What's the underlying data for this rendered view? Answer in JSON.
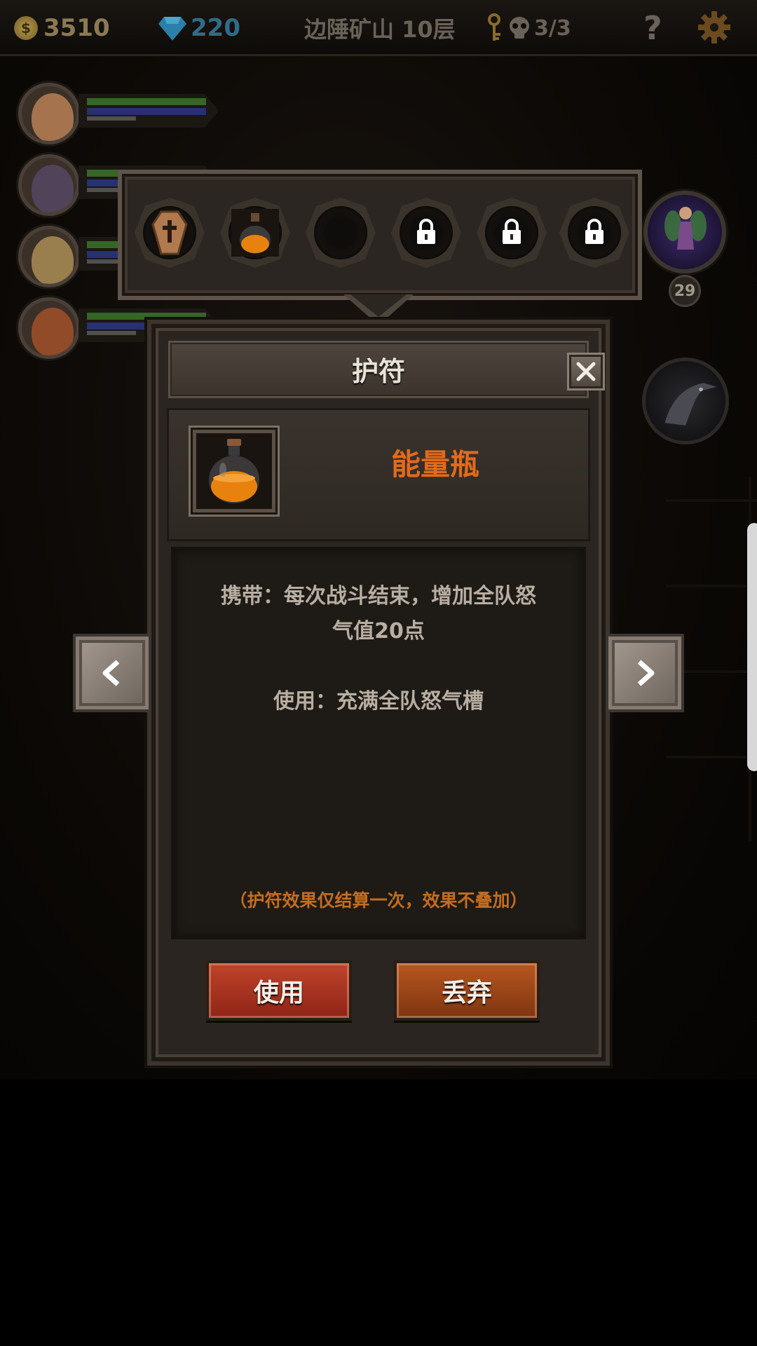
{
  "topbar": {
    "coins": "3510",
    "coin_symbol": "$",
    "gems": "220",
    "floor": "边陲矿山 10层",
    "keys_progress": "3/3",
    "help_label": "?",
    "icons": [
      "coin-icon",
      "gem-icon",
      "key-icon",
      "skull-icon",
      "help-icon",
      "gear-icon"
    ]
  },
  "side": {
    "boss_level": "29"
  },
  "amulet_slots": [
    {
      "state": "filled",
      "item": "coffin"
    },
    {
      "state": "filled",
      "item": "energy-bottle"
    },
    {
      "state": "empty"
    },
    {
      "state": "locked"
    },
    {
      "state": "locked"
    },
    {
      "state": "locked"
    }
  ],
  "dialog": {
    "title": "护符",
    "item_name": "能量瓶",
    "desc_carry_1": "携带：每次战斗结束，增加全队怒",
    "desc_carry_2": "气值20点",
    "desc_use": "使用：充满全队怒气槽",
    "note": "（护符效果仅结算一次，效果不叠加）",
    "use_label": "使用",
    "discard_label": "丢弃"
  },
  "colors": {
    "item_name": "#e36a1a",
    "note": "#c46d1e",
    "use_button": "#b23a24",
    "discard_button": "#a04a1a"
  }
}
